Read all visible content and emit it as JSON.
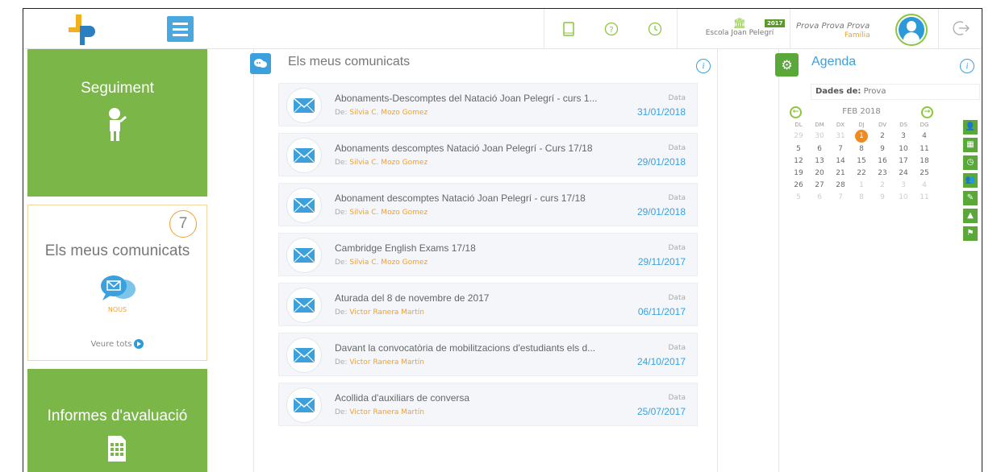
{
  "header": {
    "school_name": "Escola Joan Pelegrí",
    "year_badge": "2017",
    "user_name": "Prova Prova Prova",
    "user_role": "Família"
  },
  "left": {
    "seguiment": "Seguiment",
    "comunicats": "Els meus comunicats",
    "comunicats_count": "7",
    "nous": "NOUS",
    "veure_tots": "Veure tots",
    "informes": "Informes d'avaluació"
  },
  "main": {
    "title": "Els meus comunicats",
    "from_prefix": "De:",
    "date_label": "Data",
    "messages": [
      {
        "subject": "Abonaments-Descomptes del Natació Joan Pelegrí - curs 1...",
        "from": "Silvia C. Mozo Gomez",
        "date": "31/01/2018"
      },
      {
        "subject": "Abonaments descomptes Natació Joan Pelegrí - Curs 17/18",
        "from": "Silvia C. Mozo Gomez",
        "date": "29/01/2018"
      },
      {
        "subject": "Abonament descomptes Natació Joan Pelegrí - curs 17/18",
        "from": "Silvia C. Mozo Gomez",
        "date": "29/01/2018"
      },
      {
        "subject": "Cambridge English Exams 17/18",
        "from": "Silvia C. Mozo Gomez",
        "date": "29/11/2017"
      },
      {
        "subject": "Aturada del 8 de novembre de 2017",
        "from": "Victor Ranera Martín",
        "date": "06/11/2017"
      },
      {
        "subject": "Davant la convocatòria de mobilitzacions d'estudiants els d...",
        "from": "Victor Ranera Martín",
        "date": "24/10/2017"
      },
      {
        "subject": "Acollida d'auxiliars de conversa",
        "from": "Victor Ranera Martín",
        "date": "25/07/2017"
      }
    ]
  },
  "agenda": {
    "title": "Agenda",
    "dades_label": "Dades de:",
    "dades_value": "Prova",
    "month": "FEB 2018",
    "weekdays": [
      "DL",
      "DM",
      "DX",
      "DJ",
      "DV",
      "DS",
      "DG"
    ],
    "weeks": [
      [
        "29",
        "30",
        "31",
        "1",
        "2",
        "3",
        "4"
      ],
      [
        "5",
        "6",
        "7",
        "8",
        "9",
        "10",
        "11"
      ],
      [
        "12",
        "13",
        "14",
        "15",
        "16",
        "17",
        "18"
      ],
      [
        "19",
        "20",
        "21",
        "22",
        "23",
        "24",
        "25"
      ],
      [
        "26",
        "27",
        "28",
        "1",
        "2",
        "3",
        "4"
      ],
      [
        "5",
        "6",
        "7",
        "8",
        "9",
        "10",
        "11"
      ]
    ]
  },
  "colors": {
    "green": "#7ab648",
    "blue": "#3ba0dc",
    "orange": "#f0a030"
  }
}
